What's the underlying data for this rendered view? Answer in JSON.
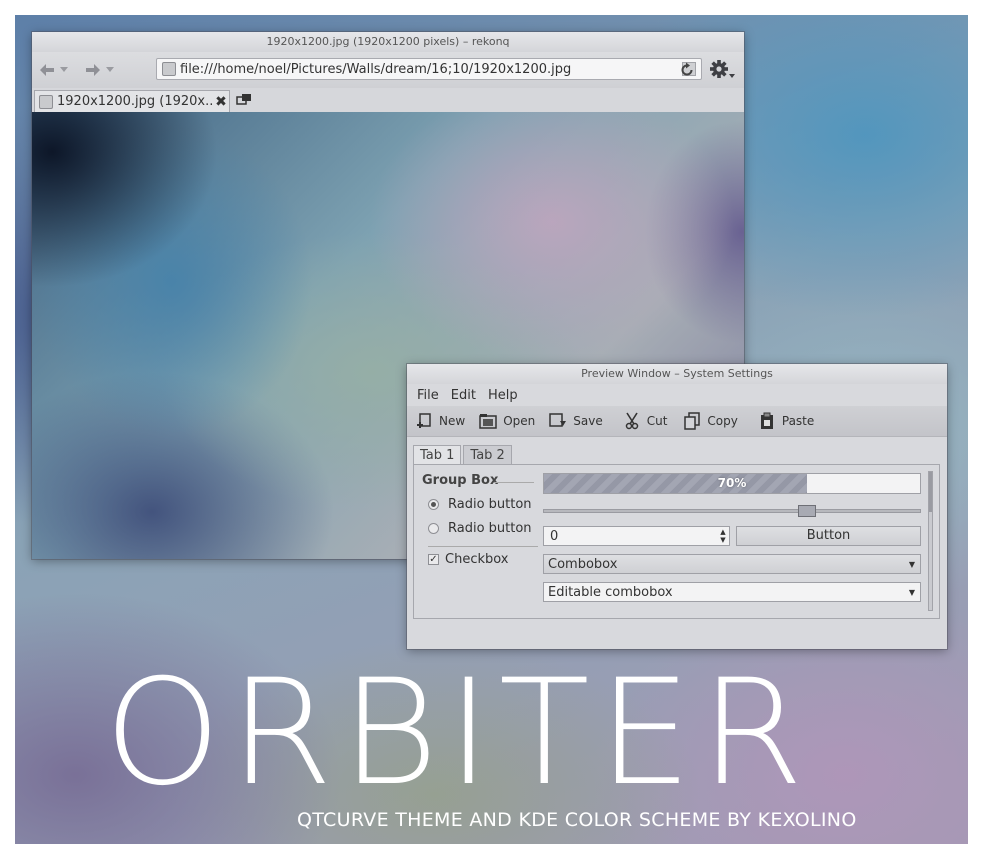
{
  "branding": {
    "title": "ORBITER",
    "subtitle": "QTCURVE THEME AND KDE COLOR SCHEME BY KEXOLINO"
  },
  "browser": {
    "window_title": "1920x1200.jpg (1920x1200 pixels) – rekonq",
    "url": "file:///home/noel/Pictures/Walls/dream/16;10/1920x1200.jpg",
    "tab_label": "1920x1200.jpg (1920x...",
    "icons": [
      "back-arrow-icon",
      "forward-arrow-icon",
      "reload-icon",
      "gear-icon",
      "close-icon",
      "new-tab-icon"
    ]
  },
  "preview": {
    "window_title": "Preview Window – System Settings",
    "menu": [
      "File",
      "Edit",
      "Help"
    ],
    "toolbar": [
      {
        "label": "New",
        "icon": "new-document-icon"
      },
      {
        "label": "Open",
        "icon": "open-folder-icon"
      },
      {
        "label": "Save",
        "icon": "save-icon"
      },
      {
        "label": "Cut",
        "icon": "scissors-icon"
      },
      {
        "label": "Copy",
        "icon": "copy-icon"
      },
      {
        "label": "Paste",
        "icon": "paste-icon"
      }
    ],
    "tabs": [
      "Tab 1",
      "Tab 2"
    ],
    "active_tab": "Tab 1",
    "group_box": "Group Box",
    "radios": [
      {
        "label": "Radio button",
        "checked": true
      },
      {
        "label": "Radio button",
        "checked": false
      }
    ],
    "checkbox": {
      "label": "Checkbox",
      "checked": true
    },
    "progress": {
      "text": "70%",
      "value": 0.7
    },
    "slider_value": 0.7,
    "spinbox_value": "0",
    "button_label": "Button",
    "combobox": "Combobox",
    "editable_combobox": "Editable combobox"
  }
}
